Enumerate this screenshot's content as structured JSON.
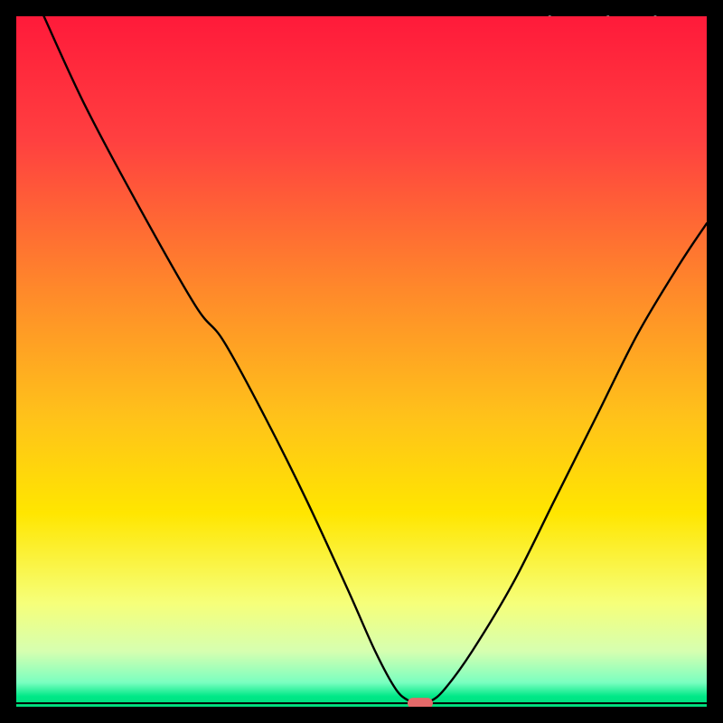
{
  "watermark": "TheBottleneck.com",
  "chart_data": {
    "type": "line",
    "title": "",
    "xlabel": "",
    "ylabel": "",
    "xlim": [
      0,
      100
    ],
    "ylim": [
      0,
      100
    ],
    "gradient_stops": [
      {
        "offset": 0.0,
        "color": "#ff1a3a"
      },
      {
        "offset": 0.18,
        "color": "#ff4040"
      },
      {
        "offset": 0.4,
        "color": "#ff8a2a"
      },
      {
        "offset": 0.58,
        "color": "#ffc21a"
      },
      {
        "offset": 0.72,
        "color": "#ffe600"
      },
      {
        "offset": 0.85,
        "color": "#f6ff7a"
      },
      {
        "offset": 0.92,
        "color": "#d6ffb0"
      },
      {
        "offset": 0.965,
        "color": "#7affc0"
      },
      {
        "offset": 0.985,
        "color": "#00e887"
      },
      {
        "offset": 1.0,
        "color": "#00e07f"
      }
    ],
    "series": [
      {
        "name": "bottleneck-curve",
        "x": [
          4,
          10,
          18,
          26,
          30,
          36,
          42,
          48,
          52,
          55,
          57,
          58.5,
          60,
          62,
          66,
          72,
          78,
          84,
          90,
          96,
          100
        ],
        "y": [
          100,
          87,
          72,
          58,
          53,
          42,
          30,
          17,
          8,
          2.5,
          0.8,
          0.5,
          0.8,
          2.5,
          8,
          18,
          30,
          42,
          54,
          64,
          70
        ]
      }
    ],
    "marker": {
      "x": 58.5,
      "y": 0.5,
      "color": "#e46a6a"
    },
    "baseline_y": 0.5
  }
}
